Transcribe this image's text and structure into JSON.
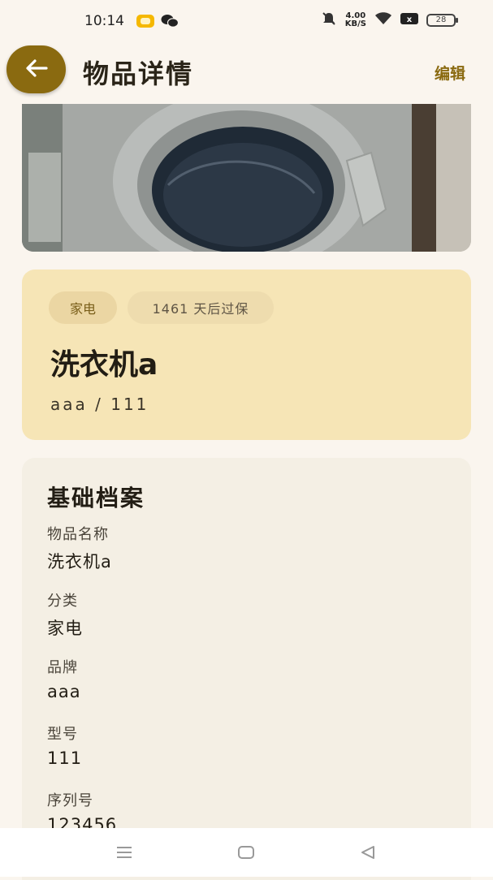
{
  "status_bar": {
    "time": "10:14",
    "net_speed_value": "4.00",
    "net_speed_unit": "KB/S",
    "battery": "28"
  },
  "app_bar": {
    "title": "物品详情",
    "edit_label": "编辑"
  },
  "summary": {
    "category_chip": "家电",
    "warranty_chip": "1461 天后过保",
    "name": "洗衣机a",
    "brand_model": "aaa / 111"
  },
  "basic_info": {
    "title": "基础档案",
    "fields": [
      {
        "label": "物品名称",
        "value": "洗衣机a"
      },
      {
        "label": "分类",
        "value": "家电"
      },
      {
        "label": "品牌",
        "value": "aaa"
      },
      {
        "label": "型号",
        "value": "111"
      },
      {
        "label": "序列号",
        "value": "123456"
      }
    ]
  },
  "icons": {
    "back": "arrow-left-icon",
    "notification": "notification-icon",
    "wechat": "wechat-icon",
    "mute": "bell-off-icon",
    "wifi": "wifi-icon",
    "sim": "sim-icon",
    "battery": "battery-icon",
    "nav_menu": "menu-icon",
    "nav_home": "home-icon",
    "nav_back": "back-triangle-icon"
  },
  "colors": {
    "accent": "#8a6a10",
    "background": "#faf5ee",
    "summary_card": "#f6e5b6",
    "info_card": "#f4efe4"
  }
}
